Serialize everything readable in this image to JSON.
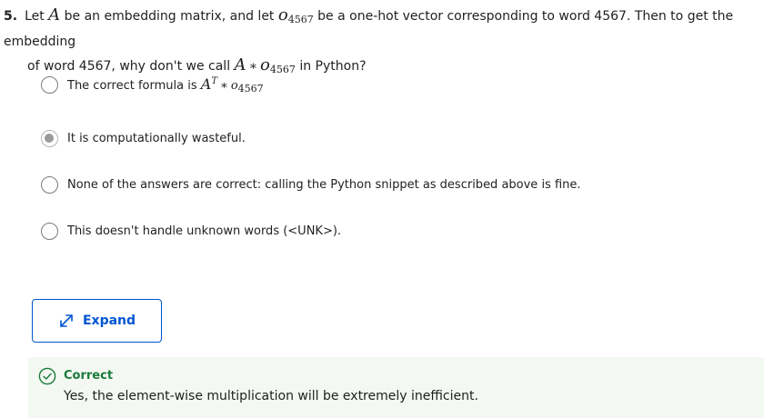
{
  "question": {
    "number": "5.",
    "part1": "Let",
    "var_a": "A",
    "part2": "be an embedding matrix, and let",
    "var_o": "o",
    "sub_o": "4567",
    "part3": "be a one-hot vector corresponding to word 4567. Then to get the embedding",
    "part4": "of word 4567, why don't we call",
    "var_a2": "A",
    "op_star": "∗",
    "var_o2": "o",
    "sub_o2": "4567",
    "part5": "in Python?"
  },
  "options": [
    {
      "label": "The correct formula is",
      "math_var": "A",
      "math_sup": "T",
      "math_op": "∗",
      "math_var2": "o",
      "math_sub": "4567",
      "selected": false
    },
    {
      "label": "It is computationally wasteful.",
      "selected": true
    },
    {
      "label": "None of the answers are correct: calling the Python snippet as described above is fine.",
      "selected": false
    },
    {
      "label": "This doesn't handle unknown words (<UNK>).",
      "selected": false
    }
  ],
  "expand_button": {
    "label": "Expand",
    "icon": "expand-arrows-icon"
  },
  "feedback": {
    "title": "Correct",
    "text": "Yes, the element-wise multiplication will be extremely inefficient.",
    "icon": "check-circle-icon",
    "color": "#1b7a3a"
  },
  "colors": {
    "accent": "#0056d2",
    "success": "#1b7a3a",
    "feedback_bg": "#f3f8f3"
  }
}
